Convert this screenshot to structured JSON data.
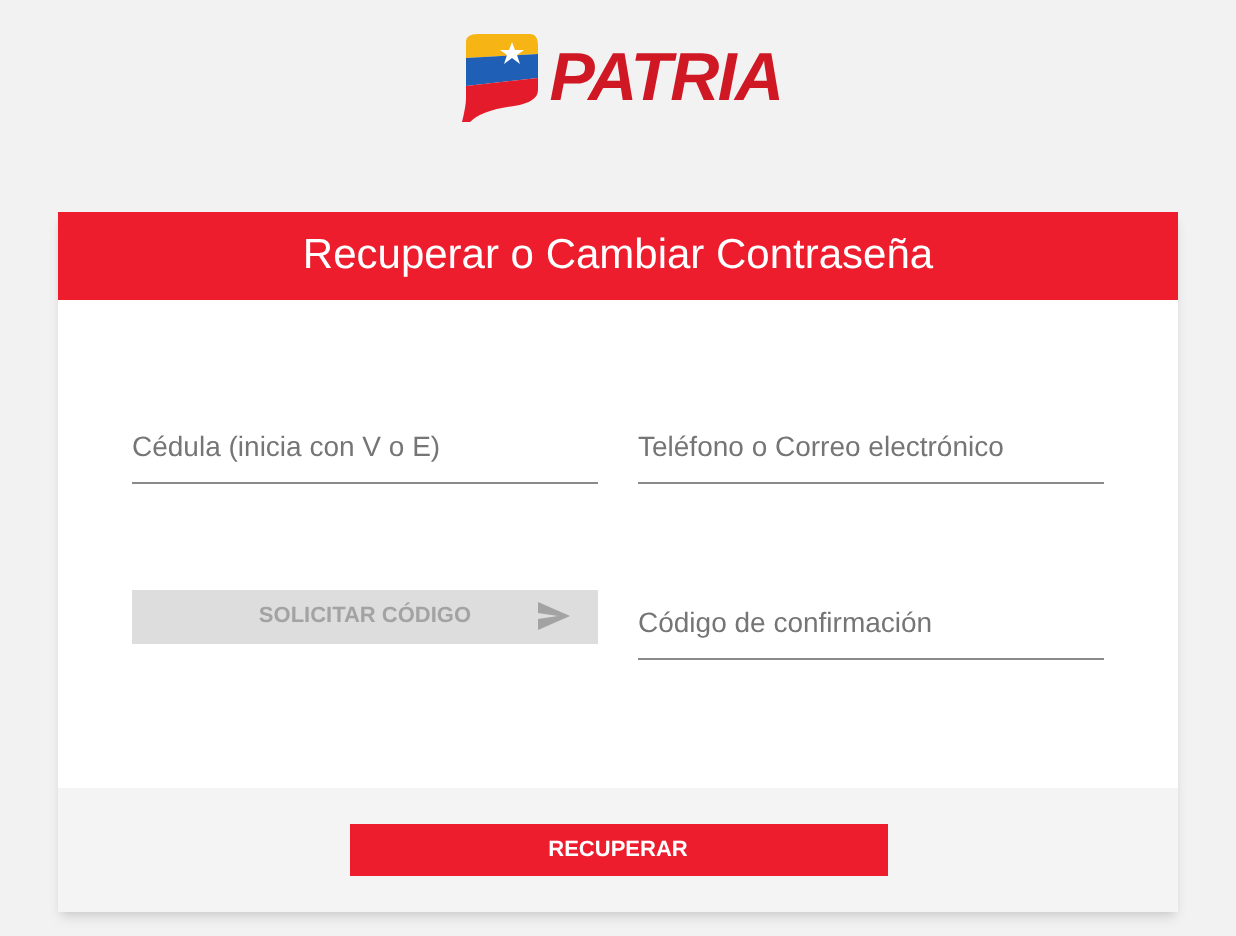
{
  "logo": {
    "text": "PATRIA"
  },
  "card": {
    "title": "Recuperar o Cambiar Contraseña",
    "fields": [
      {
        "kind": "input",
        "placeholder": "Cédula (inicia con V o E)"
      },
      {
        "kind": "input",
        "placeholder": "Teléfono o Correo electrónico"
      },
      {
        "kind": "button",
        "label": "SOLICITAR CÓDIGO",
        "disabled": true
      },
      {
        "kind": "input",
        "placeholder": "Código de confirmación"
      }
    ],
    "submit": {
      "label": "RECUPERAR"
    }
  }
}
